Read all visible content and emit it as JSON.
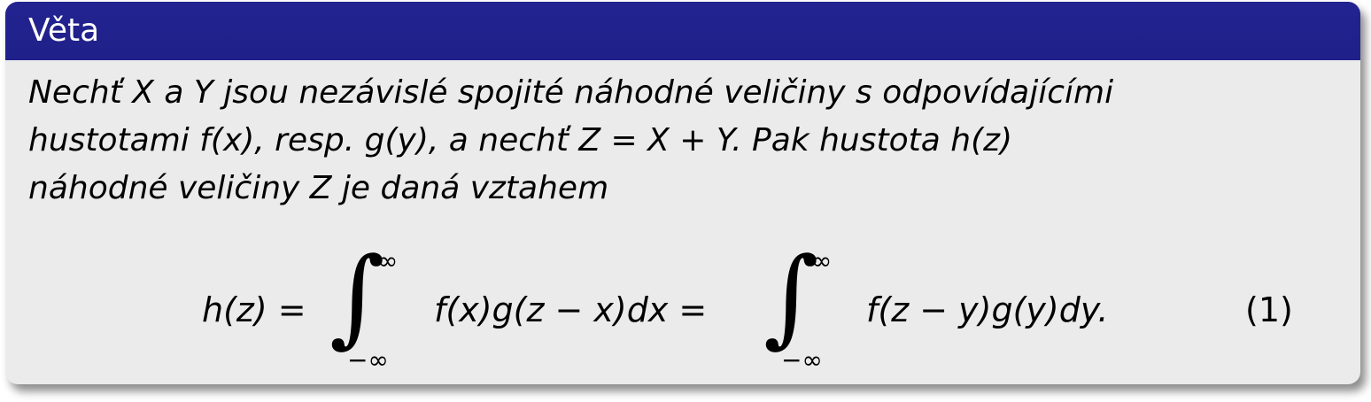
{
  "block": {
    "title": "Věta"
  },
  "theorem": {
    "line1": "Nechť X a Y jsou nezávislé spojité náhodné veličiny s odpovídajícími",
    "line2": "hustotami f(x), resp. g(y), a nechť Z = X + Y. Pak hustota h(z)",
    "line3": "náhodné veličiny Z je daná vztahem"
  },
  "equation": {
    "lhs": "h(z) =",
    "integrand1": "f(x)g(z − x)dx =",
    "integrand2": "f(z − y)g(y)dy.",
    "upper_limit": "∞",
    "lower_limit": "−∞",
    "number": "(1)"
  },
  "colors": {
    "title_bar": "#23238f",
    "title_text": "#ffffff",
    "body_bg": "#ebebeb"
  }
}
